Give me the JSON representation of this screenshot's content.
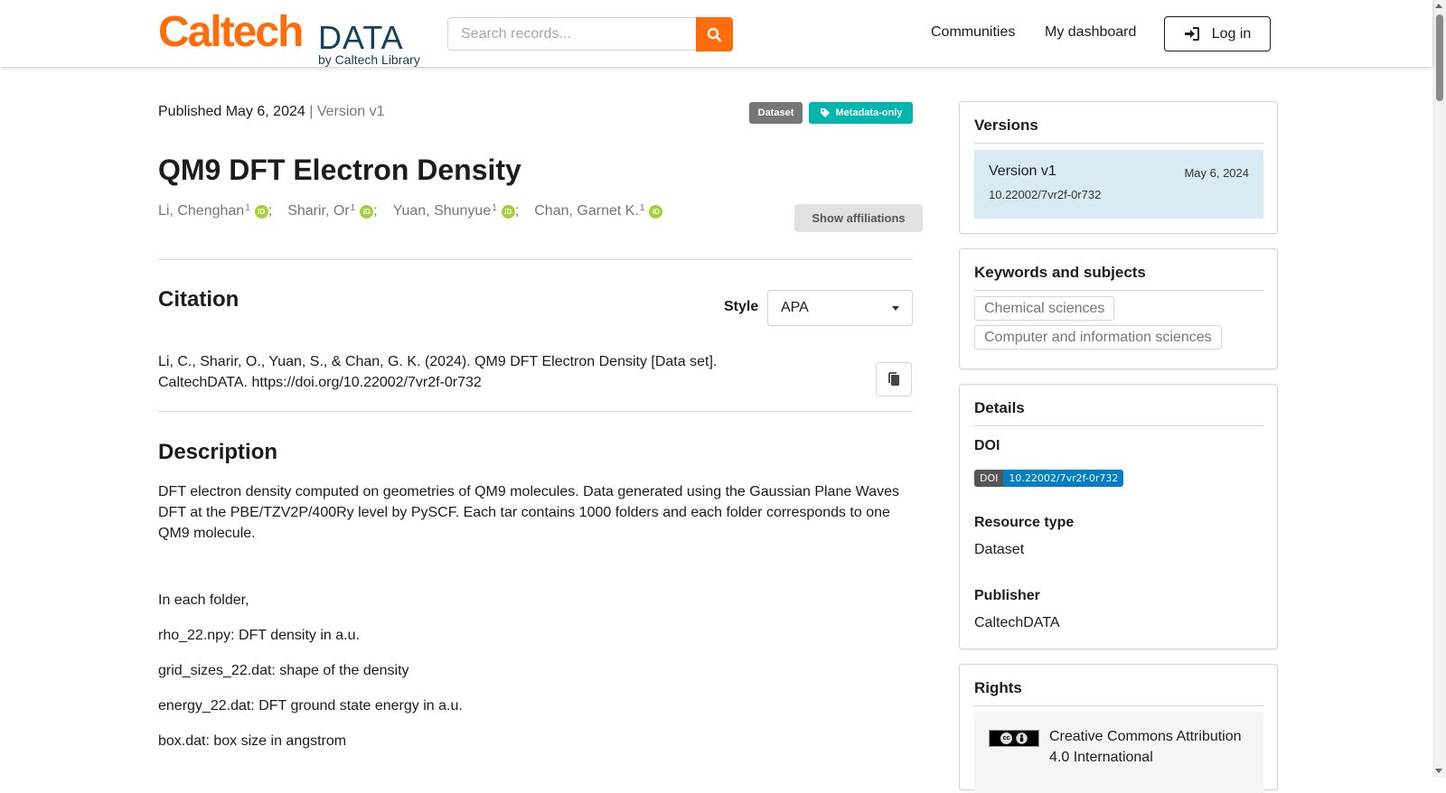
{
  "header": {
    "logo_main": "Caltech",
    "logo_data": "DATA",
    "logo_by": "by Caltech Library",
    "search_placeholder": "Search records...",
    "nav": [
      "Communities",
      "My dashboard"
    ],
    "login_label": "Log in"
  },
  "record": {
    "published": "Published May 6, 2024",
    "version": "| Version v1",
    "badges": {
      "type": "Dataset",
      "access": "Metadata-only"
    },
    "title": "QM9 DFT Electron Density",
    "creators": [
      {
        "name": "Li, Chenghan",
        "sup": "1"
      },
      {
        "name": "Sharir, Or",
        "sup": "1"
      },
      {
        "name": "Yuan, Shunyue",
        "sup": "1"
      },
      {
        "name": "Chan, Garnet K.",
        "sup": "1"
      }
    ],
    "orcid_label": "iD",
    "show_affiliations": "Show affiliations"
  },
  "citation": {
    "heading": "Citation",
    "style_label": "Style",
    "style_value": "APA",
    "text_line1": "Li, C., Sharir, O., Yuan, S., & Chan, G. K. (2024). QM9 DFT Electron Density [Data set].",
    "text_line2": "CaltechDATA. https://doi.org/10.22002/7vr2f-0r732"
  },
  "description": {
    "heading": "Description",
    "paragraph1": "DFT electron density computed on geometries of QM9 molecules.   Data generated using the Gaussian Plane Waves DFT at the PBE/TZV2P/400Ry level by PySCF.   Each tar contains 1000 folders and each folder corresponds to one QM9 molecule.",
    "lines": [
      "In each folder,",
      "rho_22.npy: DFT density in a.u.",
      "grid_sizes_22.dat: shape of the density",
      "energy_22.dat: DFT ground state energy in a.u.",
      "box.dat: box size in angstrom"
    ]
  },
  "sidebar": {
    "versions": {
      "heading": "Versions",
      "item": {
        "label": "Version v1",
        "date": "May 6, 2024",
        "doi": "10.22002/7vr2f-0r732"
      }
    },
    "keywords": {
      "heading": "Keywords and subjects",
      "items": [
        "Chemical sciences",
        "Computer and information sciences"
      ]
    },
    "details": {
      "heading": "Details",
      "doi_label": "DOI",
      "doi_badge_left": "DOI",
      "doi_badge_right": "10.22002/7vr2f-0r732",
      "resource_type_label": "Resource type",
      "resource_type_value": "Dataset",
      "publisher_label": "Publisher",
      "publisher_value": "CaltechDATA"
    },
    "rights": {
      "heading": "Rights",
      "license": "Creative Commons Attribution 4.0 International",
      "cc_icon_text": "cc"
    }
  },
  "colors": {
    "brand_orange": "#ff6c0c",
    "brand_navy": "#14415a",
    "teal_badge": "#00b5ad",
    "orcid_green": "#a6ce39",
    "version_highlight": "#d8ebf5",
    "doi_blue": "#007ec6"
  },
  "icons": {
    "search": "search-icon",
    "login": "sign-in-icon",
    "tag": "tag-icon",
    "copy": "copy-icon",
    "orcid": "orcid-icon",
    "cc": "cc-by-icon"
  }
}
